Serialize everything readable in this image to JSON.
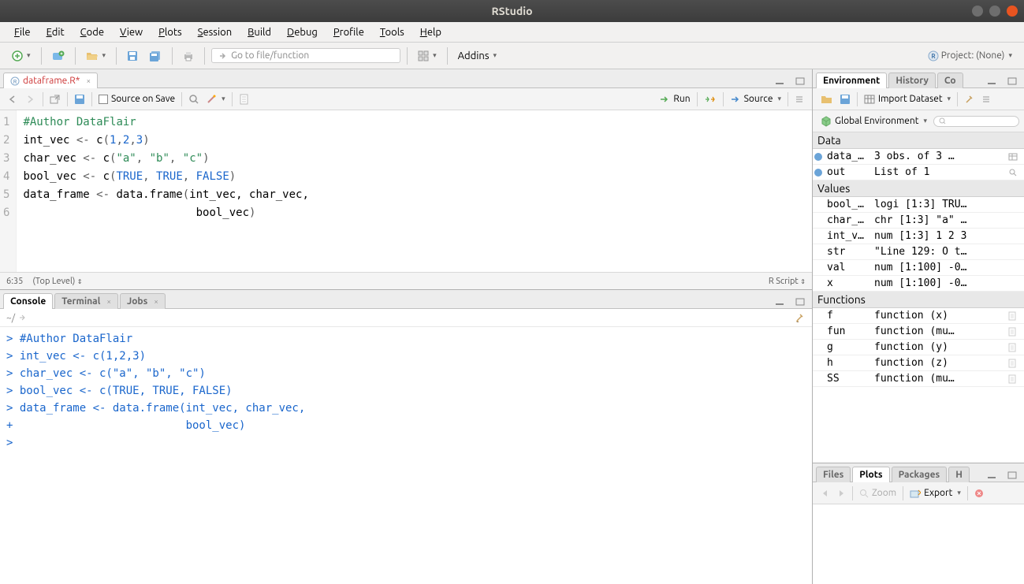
{
  "titlebar": {
    "title": "RStudio"
  },
  "menubar": {
    "items": [
      "File",
      "Edit",
      "Code",
      "View",
      "Plots",
      "Session",
      "Build",
      "Debug",
      "Profile",
      "Tools",
      "Help"
    ]
  },
  "toolbar": {
    "goto_placeholder": "Go to file/function",
    "addins": "Addins",
    "project_label": "Project: (None)"
  },
  "editor": {
    "tab_name": "dataframe.R*",
    "source_on_save": "Source on Save",
    "run": "Run",
    "source": "Source",
    "lines": [
      {
        "n": "1",
        "tokens": [
          {
            "t": "comment",
            "v": "#Author DataFlair"
          }
        ]
      },
      {
        "n": "2",
        "tokens": [
          {
            "t": "identifier",
            "v": "int_vec "
          },
          {
            "t": "operator",
            "v": "<-"
          },
          {
            "t": "identifier",
            "v": " c"
          },
          {
            "t": "paren",
            "v": "("
          },
          {
            "t": "number",
            "v": "1"
          },
          {
            "t": "paren",
            "v": ","
          },
          {
            "t": "number",
            "v": "2"
          },
          {
            "t": "paren",
            "v": ","
          },
          {
            "t": "number",
            "v": "3"
          },
          {
            "t": "paren",
            "v": ")"
          }
        ]
      },
      {
        "n": "3",
        "tokens": [
          {
            "t": "identifier",
            "v": "char_vec "
          },
          {
            "t": "operator",
            "v": "<-"
          },
          {
            "t": "identifier",
            "v": " c"
          },
          {
            "t": "paren",
            "v": "("
          },
          {
            "t": "string",
            "v": "\"a\""
          },
          {
            "t": "paren",
            "v": ", "
          },
          {
            "t": "string",
            "v": "\"b\""
          },
          {
            "t": "paren",
            "v": ", "
          },
          {
            "t": "string",
            "v": "\"c\""
          },
          {
            "t": "paren",
            "v": ")"
          }
        ]
      },
      {
        "n": "4",
        "tokens": [
          {
            "t": "identifier",
            "v": "bool_vec "
          },
          {
            "t": "operator",
            "v": "<-"
          },
          {
            "t": "identifier",
            "v": " c"
          },
          {
            "t": "paren",
            "v": "("
          },
          {
            "t": "keyword",
            "v": "TRUE"
          },
          {
            "t": "paren",
            "v": ", "
          },
          {
            "t": "keyword",
            "v": "TRUE"
          },
          {
            "t": "paren",
            "v": ", "
          },
          {
            "t": "keyword",
            "v": "FALSE"
          },
          {
            "t": "paren",
            "v": ")"
          }
        ]
      },
      {
        "n": "5",
        "tokens": [
          {
            "t": "identifier",
            "v": "data_frame "
          },
          {
            "t": "operator",
            "v": "<-"
          },
          {
            "t": "identifier",
            "v": " data.frame"
          },
          {
            "t": "paren",
            "v": "("
          },
          {
            "t": "identifier",
            "v": "int_vec, char_vec,"
          }
        ]
      },
      {
        "n": "6",
        "tokens": [
          {
            "t": "identifier",
            "v": "                          bool_vec"
          },
          {
            "t": "paren",
            "v": ")"
          }
        ]
      }
    ],
    "status_left": "6:35",
    "status_scope": "(Top Level)",
    "status_right": "R Script"
  },
  "console": {
    "tabs": [
      "Console",
      "Terminal",
      "Jobs"
    ],
    "path": "~/",
    "lines": [
      {
        "prompt": ">",
        "text": "#Author DataFlair"
      },
      {
        "prompt": ">",
        "text": "int_vec <- c(1,2,3)"
      },
      {
        "prompt": ">",
        "text": "char_vec <- c(\"a\", \"b\", \"c\")"
      },
      {
        "prompt": ">",
        "text": "bool_vec <- c(TRUE, TRUE, FALSE)"
      },
      {
        "prompt": ">",
        "text": "data_frame <- data.frame(int_vec, char_vec,"
      },
      {
        "prompt": "+",
        "text": "                         bool_vec)"
      },
      {
        "prompt": ">",
        "text": ""
      }
    ]
  },
  "environment": {
    "tabs": [
      "Environment",
      "History",
      "Co"
    ],
    "import": "Import Dataset",
    "scope": "Global Environment",
    "sections": [
      {
        "name": "Data",
        "rows": [
          {
            "name": "data_…",
            "value": "3 obs. of 3 …",
            "icon": "expandable",
            "action": "grid"
          },
          {
            "name": "out",
            "value": "List of 1",
            "icon": "expandable",
            "action": "search"
          }
        ]
      },
      {
        "name": "Values",
        "rows": [
          {
            "name": "bool_…",
            "value": "logi [1:3] TRU…"
          },
          {
            "name": "char_…",
            "value": "chr [1:3] \"a\" …"
          },
          {
            "name": "int_v…",
            "value": "num [1:3] 1 2 3"
          },
          {
            "name": "str",
            "value": "\"Line 129: O t…"
          },
          {
            "name": "val",
            "value": "num [1:100] -0…"
          },
          {
            "name": "x",
            "value": "num [1:100] -0…"
          }
        ]
      },
      {
        "name": "Functions",
        "rows": [
          {
            "name": "f",
            "value": "function (x)",
            "action": "doc"
          },
          {
            "name": "fun",
            "value": "function (mu…",
            "action": "doc"
          },
          {
            "name": "g",
            "value": "function (y)",
            "action": "doc"
          },
          {
            "name": "h",
            "value": "function (z)",
            "action": "doc"
          },
          {
            "name": "SS",
            "value": "function (mu…",
            "action": "doc"
          }
        ]
      }
    ]
  },
  "plots": {
    "tabs": [
      "Files",
      "Plots",
      "Packages",
      "H"
    ],
    "zoom": "Zoom",
    "export": "Export"
  }
}
